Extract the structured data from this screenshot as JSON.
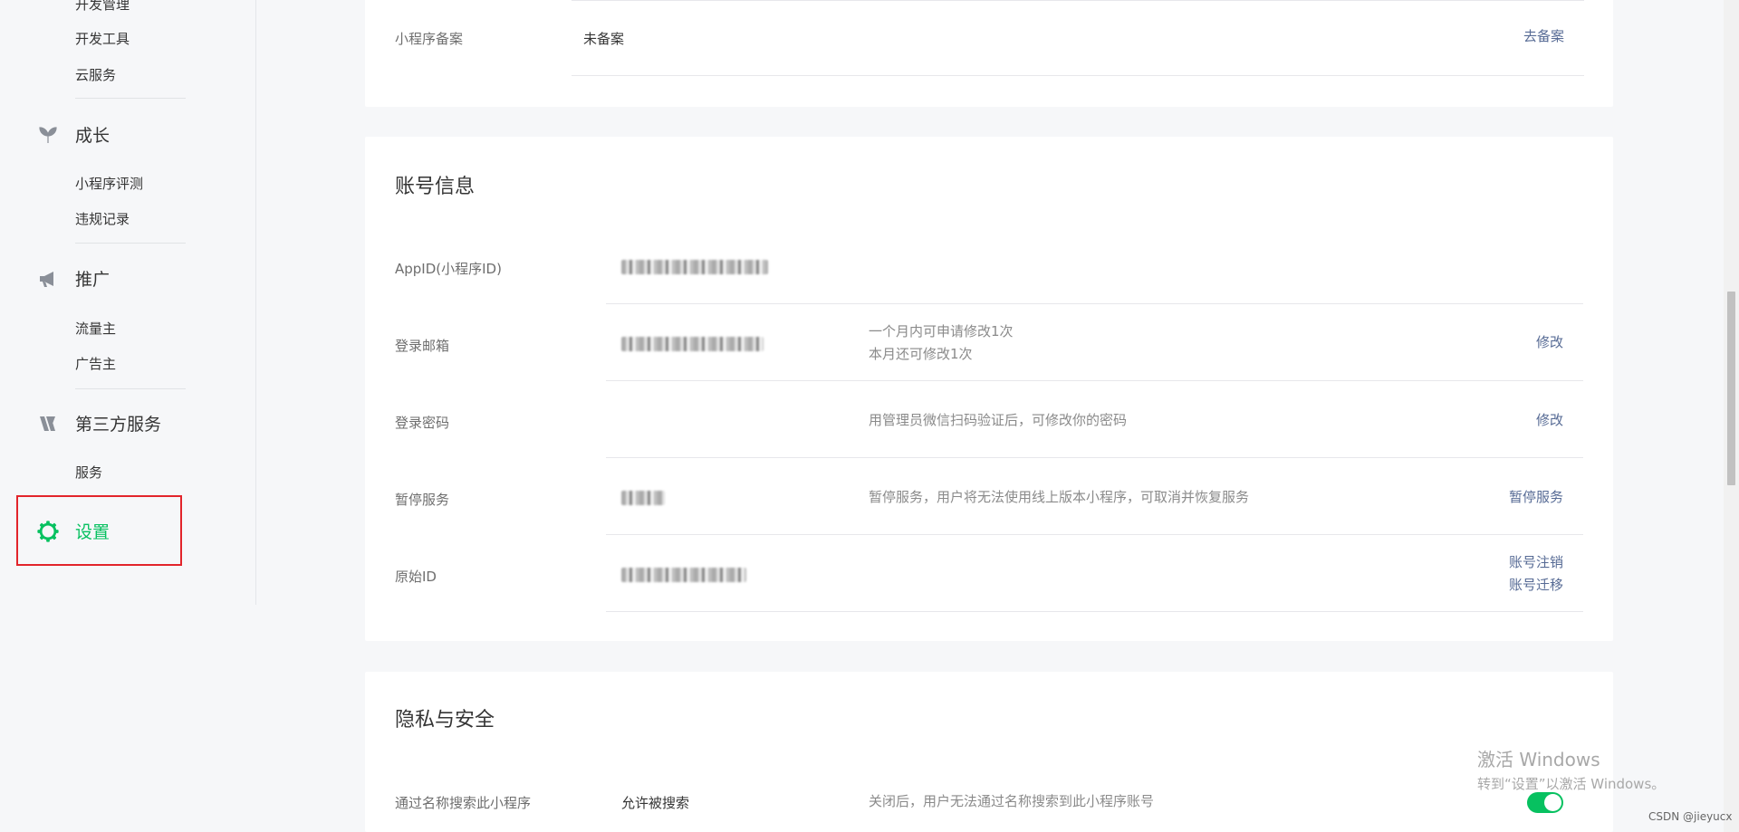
{
  "sidebar": {
    "top_items": [
      "开发管理",
      "开发工具",
      "云服务"
    ],
    "sections": [
      {
        "label": "成长",
        "icon": "sprout-icon",
        "items": [
          "小程序评测",
          "违规记录"
        ]
      },
      {
        "label": "推广",
        "icon": "megaphone-icon",
        "items": [
          "流量主",
          "广告主"
        ]
      },
      {
        "label": "第三方服务",
        "icon": "third-party-icon",
        "items": [
          "服务"
        ]
      }
    ],
    "settings": {
      "label": "设置",
      "icon": "gear-icon",
      "active_color": "#07c160",
      "highlight_color": "#e2242b"
    }
  },
  "filing": {
    "label": "小程序备案",
    "value": "未备案",
    "action": "去备案"
  },
  "account": {
    "title": "账号信息",
    "rows": [
      {
        "label": "AppID(小程序ID)",
        "value_redacted": true,
        "desc": "",
        "actions": []
      },
      {
        "label": "登录邮箱",
        "value_redacted": true,
        "desc": [
          "一个月内可申请修改1次",
          "本月还可修改1次"
        ],
        "actions": [
          "修改"
        ]
      },
      {
        "label": "登录密码",
        "value_redacted": false,
        "desc": [
          "用管理员微信扫码验证后，可修改你的密码"
        ],
        "actions": [
          "修改"
        ]
      },
      {
        "label": "暂停服务",
        "value_redacted": true,
        "desc": [
          "暂停服务，用户将无法使用线上版本小程序，可取消并恢复服务"
        ],
        "actions": [
          "暂停服务"
        ]
      },
      {
        "label": "原始ID",
        "value_redacted": true,
        "desc": "",
        "actions": [
          "账号注销",
          "账号迁移"
        ]
      }
    ]
  },
  "privacy": {
    "title": "隐私与安全",
    "rows": [
      {
        "label": "通过名称搜索此小程序",
        "value": "允许被搜索",
        "desc": "关闭后，用户无法通过名称搜索到此小程序账号",
        "toggle_on": true
      }
    ]
  },
  "watermark": {
    "line1": "激活 Windows",
    "line2": "转到“设置”以激活 Windows。"
  },
  "csdn": "CSDN @jieyucx",
  "colors": {
    "link": "#576b95",
    "accent": "#07c160"
  }
}
